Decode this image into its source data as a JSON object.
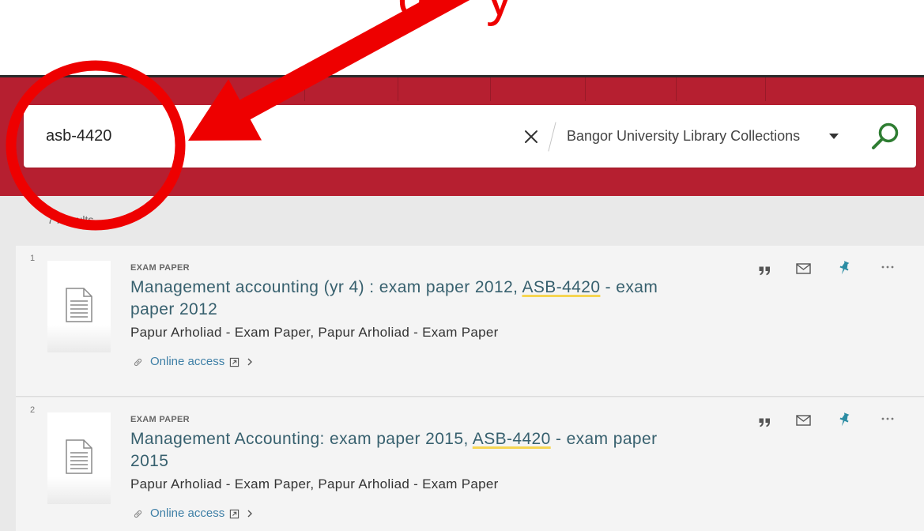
{
  "annotation": {
    "fragments": [
      "g",
      "y"
    ],
    "color": "#ee0000"
  },
  "theme": {
    "header_red": "#b61f30",
    "search_green": "#2e7d32",
    "title_color": "#37606e",
    "link_color": "#3e7fa6",
    "pin_color": "#2b8ca3",
    "highlight": "#f6d552"
  },
  "search": {
    "query": "asb-4420",
    "scope": "Bangor University Library Collections",
    "icons": {
      "clear": "close-icon",
      "scope_toggle": "caret-down-icon",
      "submit": "search-icon"
    }
  },
  "results": {
    "count_label": "7 Results",
    "action_icons": [
      "quote-icon",
      "mail-icon",
      "pin-icon",
      "more-icon"
    ],
    "access_icons": [
      "link-icon",
      "external-link-icon",
      "chevron-right-icon"
    ],
    "items": [
      {
        "index": "1",
        "type": "EXAM PAPER",
        "thumbnail_icon": "document-icon",
        "title": [
          {
            "text": "Management accounting (yr 4) : exam paper 2012, ",
            "highlight": false
          },
          {
            "text": "ASB-4420",
            "highlight": true
          },
          {
            "text": " - exam paper 2012",
            "highlight": false
          }
        ],
        "creator": "Papur Arholiad - Exam Paper, Papur Arholiad - Exam Paper",
        "access": "Online access"
      },
      {
        "index": "2",
        "type": "EXAM PAPER",
        "thumbnail_icon": "document-icon",
        "title": [
          {
            "text": "Management Accounting: exam paper 2015, ",
            "highlight": false
          },
          {
            "text": "ASB-4420",
            "highlight": true
          },
          {
            "text": " - exam paper 2015",
            "highlight": false
          }
        ],
        "creator": "Papur Arholiad - Exam Paper, Papur Arholiad - Exam Paper",
        "access": "Online access"
      }
    ]
  }
}
